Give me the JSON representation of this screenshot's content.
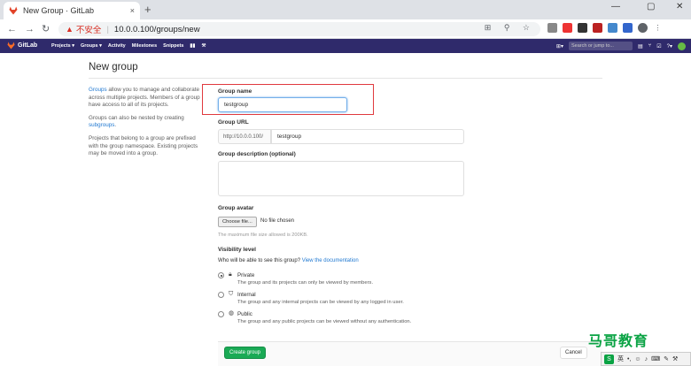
{
  "browser": {
    "tab_title": "New Group · GitLab",
    "tab_close": "×",
    "new_tab": "+",
    "security_label": "不安全",
    "url_separator": "|",
    "url": "10.0.0.100/groups/new",
    "window_controls": [
      "—",
      "▢",
      "✕"
    ]
  },
  "gitlab_nav": {
    "brand": "GitLab",
    "menu": [
      "Projects ▾",
      "Groups ▾",
      "Activity",
      "Milestones",
      "Snippets"
    ],
    "search_placeholder": "Search or jump to..."
  },
  "page": {
    "title": "New group",
    "help": {
      "p1_link": "Groups",
      "p1_text": " allow you to manage and collaborate across multiple projects. Members of a group have access to all of its projects.",
      "p2_text": "Groups can also be nested by creating ",
      "p2_link": "subgroups",
      "p2_end": ".",
      "p3_text": "Projects that belong to a group are prefixed with the group namespace. Existing projects may be moved into a group."
    },
    "form": {
      "group_name_label": "Group name",
      "group_name_value": "testgroup",
      "group_url_label": "Group URL",
      "group_url_prefix": "http://10.0.0.100/",
      "group_url_value": "testgroup",
      "description_label": "Group description (optional)",
      "avatar_label": "Group avatar",
      "choose_file_button": "Choose file...",
      "no_file_text": "No file chosen",
      "avatar_hint": "The maximum file size allowed is 200KB.",
      "visibility_label": "Visibility level",
      "visibility_question": "Who will be able to see this group?",
      "visibility_doc_link": "View the documentation",
      "visibility_options": [
        {
          "title": "Private",
          "desc": "The group and its projects can only be viewed by members.",
          "checked": true
        },
        {
          "title": "Internal",
          "desc": "The group and any internal projects can be viewed by any logged in user.",
          "checked": false
        },
        {
          "title": "Public",
          "desc": "The group and any public projects can be viewed without any authentication.",
          "checked": false
        }
      ],
      "create_button": "Create group",
      "cancel_button": "Cancel"
    }
  },
  "overlay": {
    "watermark": "马哥教育",
    "ime_label": "英"
  },
  "colors": {
    "gitlab_nav": "#2f2a6b",
    "primary_green": "#1aaa55",
    "link_blue": "#1f78d1",
    "highlight_red": "#e0393e"
  }
}
